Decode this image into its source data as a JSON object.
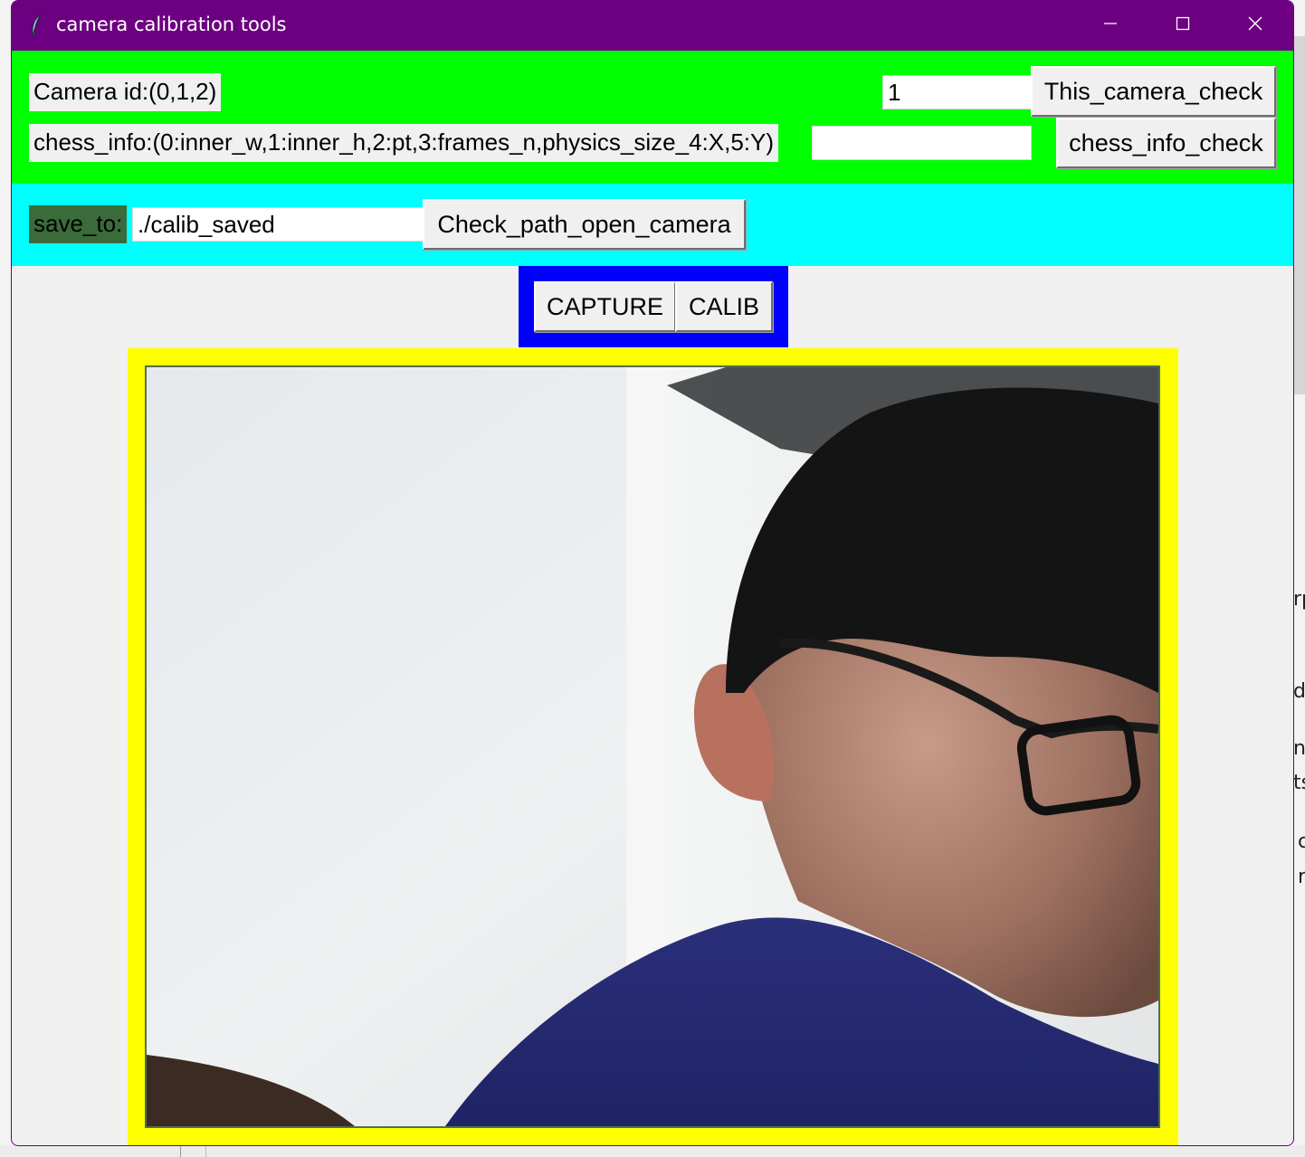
{
  "window": {
    "title": "camera calibration tools",
    "controls": {
      "minimize": "minimize",
      "maximize": "maximize",
      "close": "close"
    }
  },
  "camera_row": {
    "label": "Camera id:(0,1,2)",
    "input_value": "1",
    "button": "This_camera_check"
  },
  "chess_row": {
    "label": "chess_info:(0:inner_w,1:inner_h,2:pt,3:frames_n,physics_size_4:X,5:Y)",
    "input_value": "",
    "button": "chess_info_check"
  },
  "save_row": {
    "label": "save_to:",
    "input_value": "./calib_saved",
    "button": "Check_path_open_camera"
  },
  "actions": {
    "capture": "CAPTURE",
    "calib": "CALIB"
  },
  "background_fragments": [
    "rp",
    "d",
    "n",
    "ts",
    "c",
    "r"
  ],
  "colors": {
    "titlebar": "#6c0080",
    "frame_camera": "#00ff00",
    "frame_save": "#00ffff",
    "frame_actions": "#0000ff",
    "frame_video": "#ffff00",
    "save_label_bg": "#3b6b3b"
  },
  "icons": [
    "feather-icon",
    "minimize-icon",
    "maximize-icon",
    "close-icon"
  ]
}
